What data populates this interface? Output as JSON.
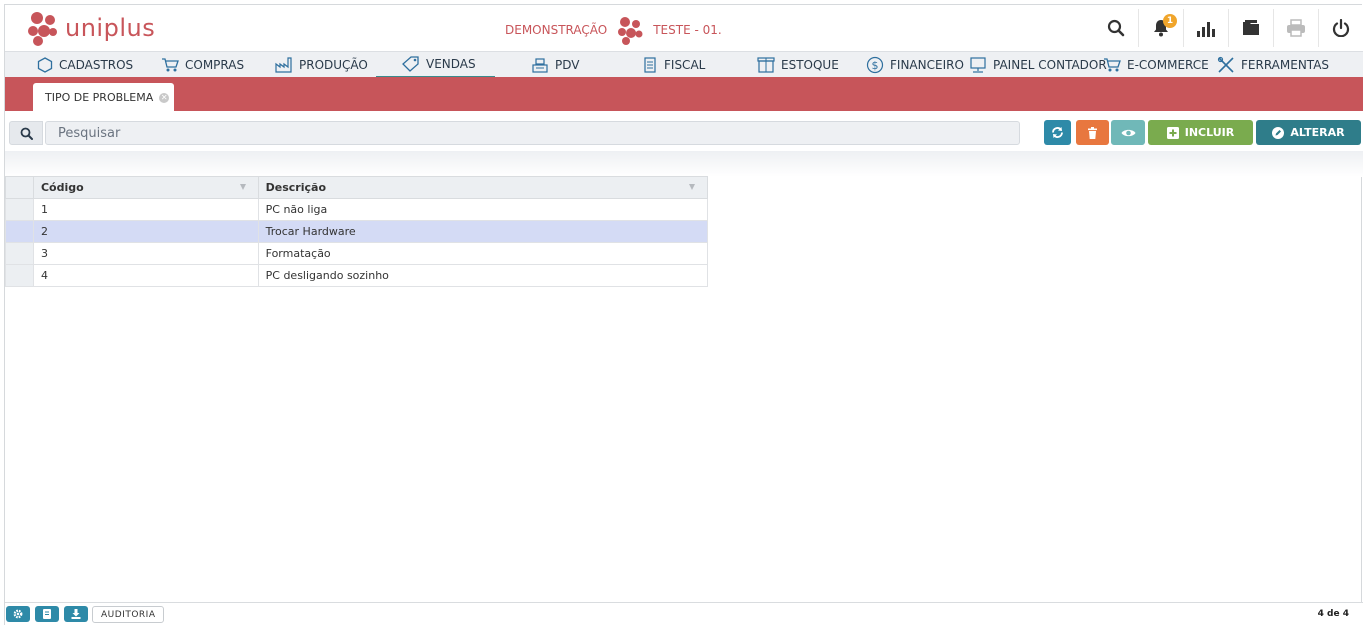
{
  "app": {
    "name": "uniplus"
  },
  "header": {
    "environment": "DEMONSTRAÇÃO",
    "company": "TESTE - 01.",
    "notification_count": "1"
  },
  "menu": [
    {
      "label": "CADASTROS",
      "icon": "hexagon-icon"
    },
    {
      "label": "COMPRAS",
      "icon": "cart-icon"
    },
    {
      "label": "PRODUÇÃO",
      "icon": "factory-icon"
    },
    {
      "label": "VENDAS",
      "icon": "tag-icon",
      "active": true
    },
    {
      "label": "PDV",
      "icon": "register-icon"
    },
    {
      "label": "FISCAL",
      "icon": "document-icon"
    },
    {
      "label": "ESTOQUE",
      "icon": "box-icon"
    },
    {
      "label": "FINANCEIRO",
      "icon": "dollar-icon"
    },
    {
      "label": "PAINEL CONTADOR",
      "icon": "monitor-icon"
    },
    {
      "label": "E-COMMERCE",
      "icon": "cart-icon"
    },
    {
      "label": "FERRAMENTAS",
      "icon": "tools-icon"
    }
  ],
  "tab": {
    "label": "TIPO DE PROBLEMA"
  },
  "search": {
    "placeholder": "Pesquisar"
  },
  "toolbar": {
    "incluir_label": "INCLUIR",
    "alterar_label": "ALTERAR"
  },
  "table": {
    "columns": [
      "Código",
      "Descrição"
    ],
    "rows": [
      [
        "1",
        "PC não liga"
      ],
      [
        "2",
        "Trocar Hardware"
      ],
      [
        "3",
        "Formatação"
      ],
      [
        "4",
        "PC desligando sozinho"
      ]
    ],
    "selected_row": 1
  },
  "footer": {
    "audit_label": "AUDITORIA",
    "record_count": "4 de 4"
  },
  "colors": {
    "brand": "#c7555a",
    "teal": "#2e8aa8",
    "orange": "#e8773f",
    "green": "#7aab4e",
    "dark_teal": "#2f7d8a"
  }
}
